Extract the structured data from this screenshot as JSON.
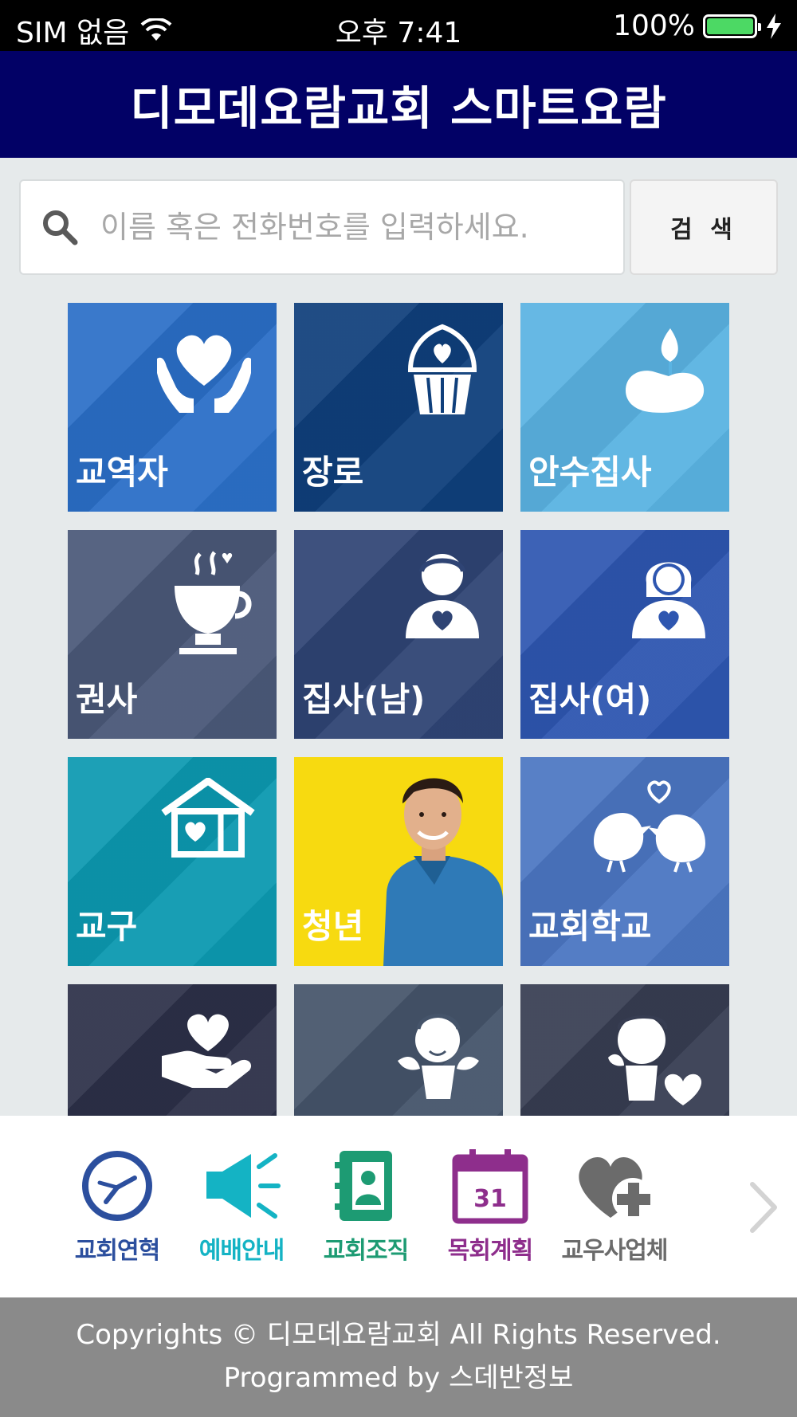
{
  "status_bar": {
    "carrier": "SIM 없음",
    "time": "오후 7:41",
    "battery": "100%"
  },
  "header": {
    "title": "디모데요람교회 스마트요람"
  },
  "search": {
    "placeholder": "이름 혹은 전화번호를 입력하세요.",
    "value": "",
    "button": "검 색"
  },
  "tiles": [
    {
      "label": "교역자",
      "color": "#2b6fc7",
      "icon": "hands-heart-icon"
    },
    {
      "label": "장로",
      "color": "#0f3f7b",
      "icon": "cupcake-heart-icon"
    },
    {
      "label": "안수집사",
      "color": "#5ab3e2",
      "icon": "candle-icon"
    },
    {
      "label": "권사",
      "color": "#4a5878",
      "icon": "coffee-cup-icon"
    },
    {
      "label": "집사(남)",
      "color": "#2f4474",
      "icon": "man-heart-icon"
    },
    {
      "label": "집사(여)",
      "color": "#2e56b0",
      "icon": "woman-heart-icon"
    },
    {
      "label": "교구",
      "color": "#0c99b0",
      "icon": "house-heart-icon"
    },
    {
      "label": "청년",
      "color": "#f7da10",
      "icon": "young-man-photo"
    },
    {
      "label": "교회학교",
      "color": "#4b76c2",
      "icon": "birds-heart-icon"
    },
    {
      "label": "",
      "color": "#2c3048",
      "icon": "hand-heart-icon"
    },
    {
      "label": "",
      "color": "#45546a",
      "icon": "angel-icon"
    },
    {
      "label": "",
      "color": "#373d52",
      "icon": "cherub-heart-icon"
    }
  ],
  "bottom_nav": [
    {
      "label": "교회연혁",
      "color": "#2c4f9e",
      "icon": "clock-icon"
    },
    {
      "label": "예배안내",
      "color": "#14b3c4",
      "icon": "megaphone-icon"
    },
    {
      "label": "교회조직",
      "color": "#1d9b73",
      "icon": "address-book-icon"
    },
    {
      "label": "목회계획",
      "color": "#8e2e8c",
      "icon": "calendar-icon",
      "calendar_day": "31"
    },
    {
      "label": "교우사업체",
      "color": "#6b6b6b",
      "icon": "heart-plus-icon"
    }
  ],
  "footer": {
    "line1": "Copyrights © 디모데요람교회 All Rights Reserved.",
    "line2": "Programmed by 스데반정보"
  }
}
